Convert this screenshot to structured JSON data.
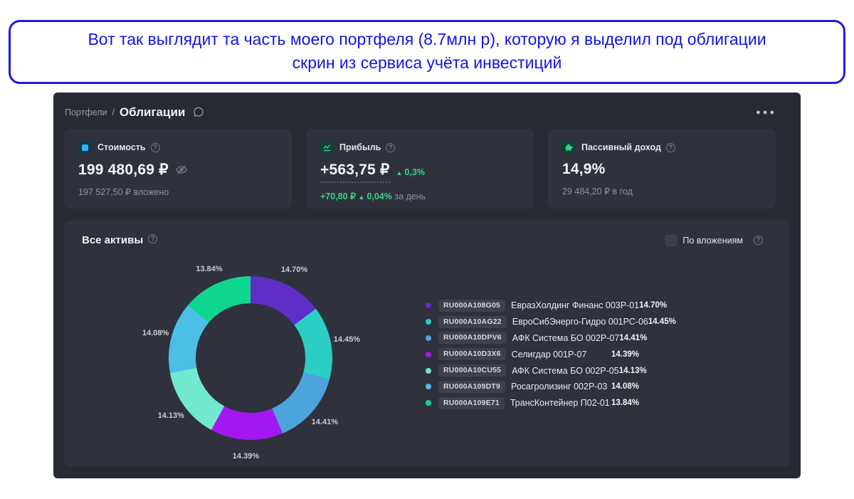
{
  "banner": {
    "line1": "Вот так выглядит та часть моего портфеля (8.7млн р), которую я выделил под облигации",
    "line2": "скрин из сервиса учёта инвестиций"
  },
  "header": {
    "breadcrumb_root": "Портфели",
    "title": "Облигации"
  },
  "icons": {
    "question": "?",
    "dots_menu": "●●●",
    "up_triangle": "▲"
  },
  "cards": {
    "value": {
      "label": "Стоимость",
      "value": "199 480,69 ₽",
      "sub": "197 527,50 ₽ вложено"
    },
    "profit": {
      "label": "Прибыль",
      "value": "+563,75 ₽",
      "delta_total": "0,3%",
      "delta_day_amount": "+70,80 ₽",
      "delta_day_pct": "0,04%",
      "delta_day_suffix": "за день"
    },
    "passive": {
      "label": "Пассивный доход",
      "value": "14,9%",
      "sub": "29 484,20 ₽ в год"
    }
  },
  "assets": {
    "title": "Все активы",
    "toggle_label": "По вложениям"
  },
  "chart_data": {
    "type": "pie",
    "subtype": "donut",
    "legend_position": "right",
    "series": [
      {
        "ticker": "RU000A108G05",
        "name": "ЕвразХолдинг Финанс 003Р-01",
        "pct": 14.7,
        "color": "#5f2ec7"
      },
      {
        "ticker": "RU000A10AG22",
        "name": "ЕвроСибЭнерго-Гидро 001РС-06",
        "pct": 14.45,
        "color": "#2bcec5"
      },
      {
        "ticker": "RU000A10DPV6",
        "name": "АФК Система БО 002Р-07",
        "pct": 14.41,
        "color": "#4da4dc"
      },
      {
        "ticker": "RU000A10D3X6",
        "name": "Селигдар 001Р-07",
        "pct": 14.39,
        "color": "#a318f0"
      },
      {
        "ticker": "RU000A10CU55",
        "name": "АФК Система БО 002Р-05",
        "pct": 14.13,
        "color": "#70e9ce"
      },
      {
        "ticker": "RU000A109DT9",
        "name": "Росагролизинг 002Р-03",
        "pct": 14.08,
        "color": "#4bbfe6"
      },
      {
        "ticker": "RU000A109E71",
        "name": "ТрансКонтейнер П02-01",
        "pct": 13.84,
        "color": "#0fd68f"
      }
    ]
  }
}
